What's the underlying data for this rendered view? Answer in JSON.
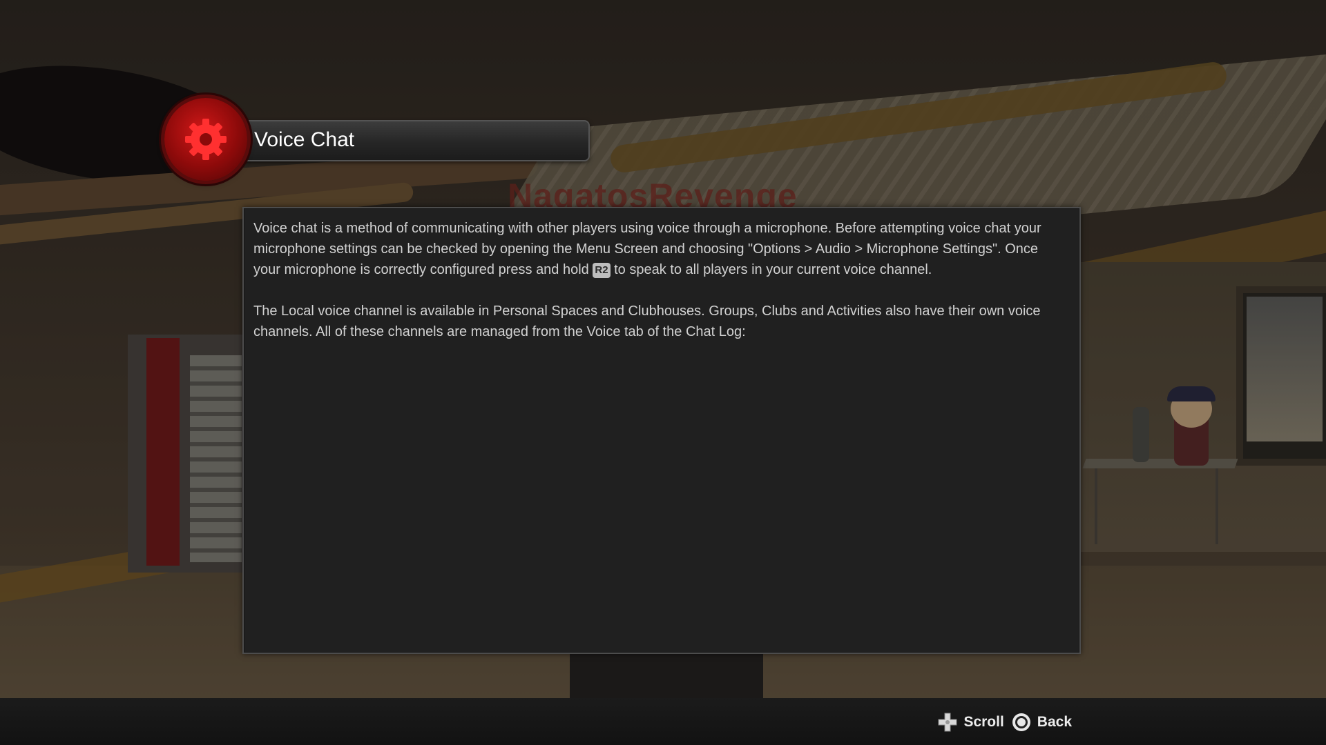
{
  "header": {
    "title": "Voice Chat",
    "icon": "gear-icon",
    "badge_color": "#c01414"
  },
  "background": {
    "logo_text": "NagatosRevenge"
  },
  "content": {
    "p1_part1": "Voice chat is a method of communicating with other players using voice through a microphone.  Before attempting voice chat your microphone settings can be checked by opening the Menu Screen and choosing \"Options > Audio > Microphone Settings\".  Once your microphone is correctly configured press and hold ",
    "p1_button": "R2",
    "p1_part2": " to speak to all players in your current voice channel.",
    "p2": "The Local voice channel is available in Personal Spaces and Clubhouses.  Groups, Clubs and Activities also have their own voice channels.  All of these channels are managed from the Voice tab of the Chat Log:"
  },
  "footer": {
    "scroll_label": "Scroll",
    "scroll_icon": "dpad-icon",
    "back_label": "Back",
    "back_icon": "circle-button-icon"
  }
}
